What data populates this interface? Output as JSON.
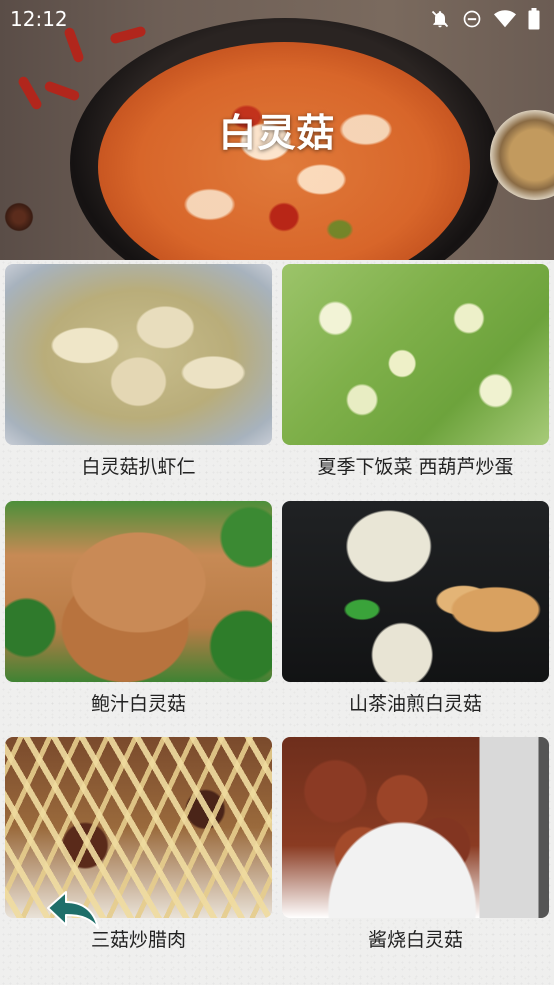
{
  "status_bar": {
    "time": "12:12",
    "icons": [
      "notifications-off-icon",
      "do-not-disturb-icon",
      "wifi-icon",
      "battery-icon"
    ]
  },
  "header": {
    "title": "白灵菇"
  },
  "recipes": [
    {
      "title": "白灵菇扒虾仁"
    },
    {
      "title": "夏季下饭菜 西葫芦炒蛋"
    },
    {
      "title": "鲍汁白灵菇"
    },
    {
      "title": "山茶油煎白灵菇"
    },
    {
      "title": "三菇炒腊肉"
    },
    {
      "title": "酱烧白灵菇"
    }
  ],
  "colors": {
    "caption_text": "#222222",
    "title_text": "#ffffff",
    "back_arrow": "#1f6f6a"
  }
}
